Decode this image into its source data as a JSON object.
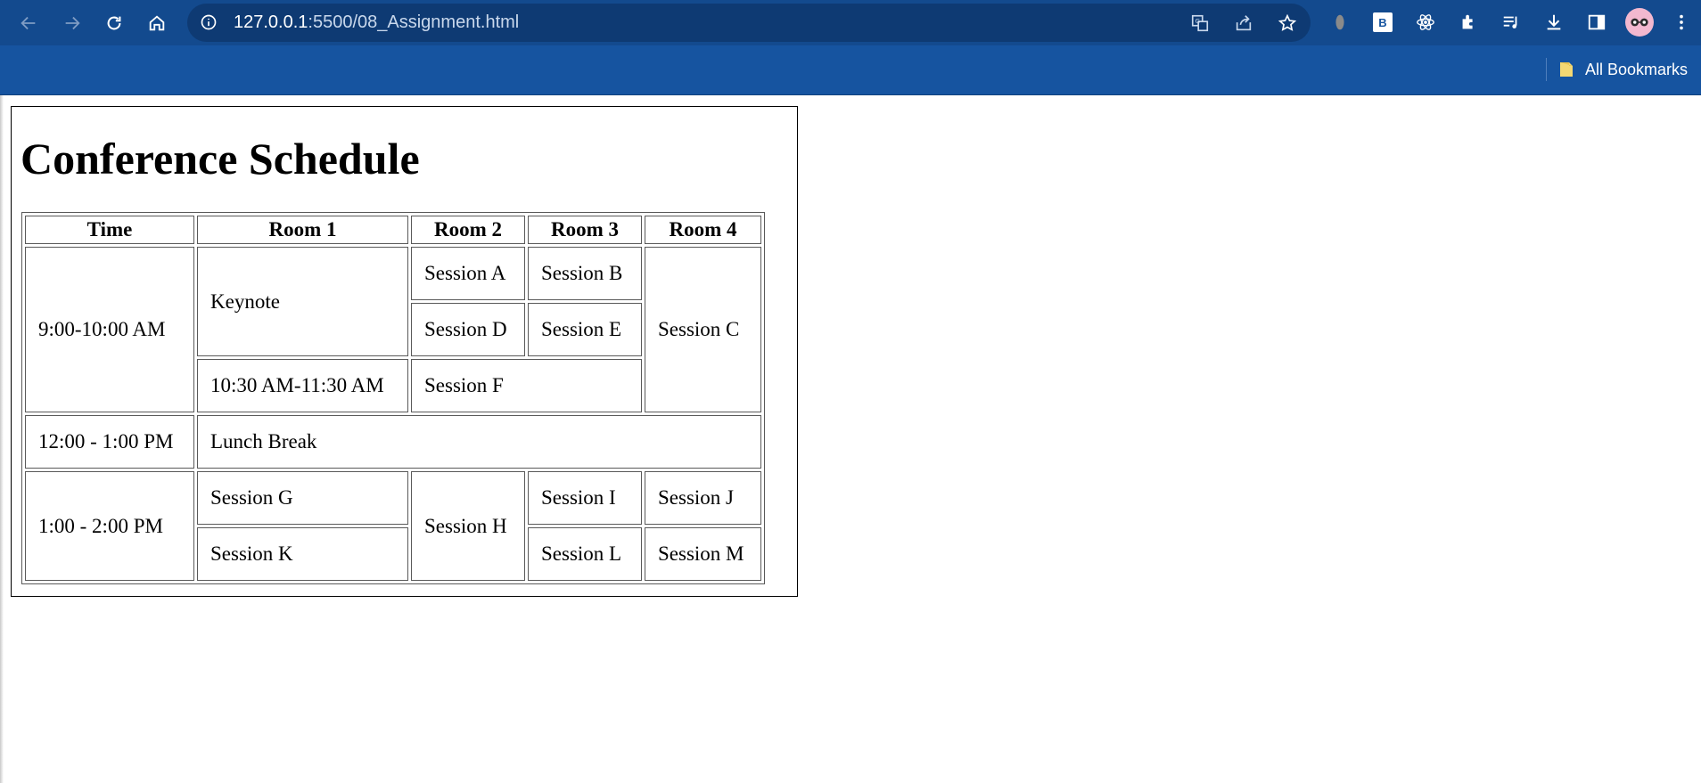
{
  "browser": {
    "url_host": "127.0.0.1",
    "url_path": ":5500/08_Assignment.html",
    "bookmarks_label": "All Bookmarks",
    "extension_b_label": "B",
    "theme_color": "#1654a0"
  },
  "page": {
    "title": "Conference Schedule"
  },
  "schedule": {
    "headers": [
      "Time",
      "Room 1",
      "Room 2",
      "Room 3",
      "Room 4"
    ],
    "slot1": {
      "time": "9:00-10:00 AM",
      "keynote": "Keynote",
      "session_a": "Session A",
      "session_b": "Session B",
      "session_c": "Session C",
      "session_d": "Session D",
      "session_e": "Session E",
      "time_2": "10:30 AM-11:30 AM",
      "session_f": "Session F"
    },
    "slot2": {
      "time": "12:00 - 1:00 PM",
      "lunch": "Lunch Break"
    },
    "slot3": {
      "time": "1:00 - 2:00 PM",
      "session_g": "Session G",
      "session_h": "Session H",
      "session_i": "Session I",
      "session_j": "Session J",
      "session_k": "Session K",
      "session_l": "Session L",
      "session_m": "Session M"
    }
  }
}
